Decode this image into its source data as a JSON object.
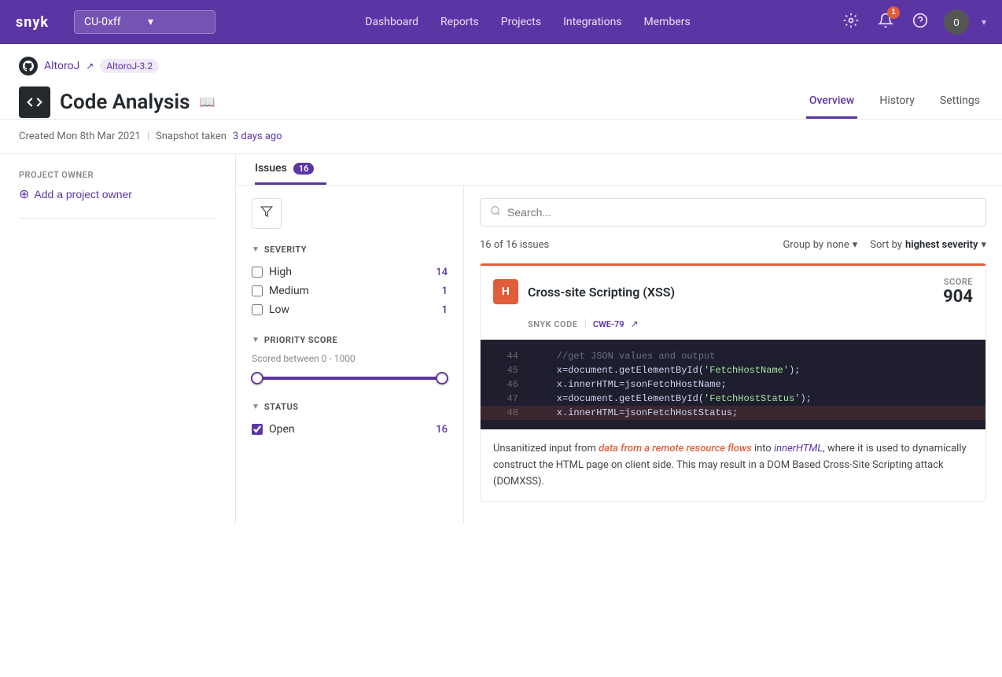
{
  "topnav": {
    "logo": "snyk",
    "org_selector": "CU-0xff",
    "nav_items": [
      "Dashboard",
      "Reports",
      "Projects",
      "Integrations",
      "Members"
    ],
    "notification_count": "1",
    "avatar_label": "0"
  },
  "breadcrumb": {
    "repo_name": "AltoroJ",
    "repo_tag": "AltoroJ-3.2",
    "external_icon": "↗"
  },
  "page": {
    "title": "Code Analysis",
    "doc_icon": "📖",
    "code_icon": "</>",
    "tabs": [
      "Overview",
      "History",
      "Settings"
    ],
    "active_tab": "Overview"
  },
  "sub_header": {
    "created": "Created Mon 8th Mar 2021",
    "snapshot_text": "Snapshot taken",
    "snapshot_link": "3 days ago"
  },
  "sidebar": {
    "project_owner_label": "PROJECT OWNER",
    "add_owner_label": "Add a project owner"
  },
  "issues_tab": {
    "label": "Issues",
    "count": "16"
  },
  "filters": {
    "severity_label": "SEVERITY",
    "severity_items": [
      {
        "label": "High",
        "count": "14",
        "checked": false
      },
      {
        "label": "Medium",
        "count": "1",
        "checked": false
      },
      {
        "label": "Low",
        "count": "1",
        "checked": false
      }
    ],
    "priority_score_label": "PRIORITY SCORE",
    "priority_range_label": "Scored between 0 - 1000",
    "priority_min": 0,
    "priority_max": 1000,
    "priority_thumb_left_pct": 3,
    "priority_thumb_right_pct": 97,
    "status_label": "STATUS",
    "status_items": [
      {
        "label": "Open",
        "count": "16",
        "checked": true
      }
    ]
  },
  "issues_list": {
    "count_text": "16 of 16 issues",
    "search_placeholder": "Search...",
    "group_by_label": "Group by",
    "group_by_value": "none",
    "sort_by_label": "Sort by",
    "sort_by_value": "highest severity"
  },
  "issue_card": {
    "severity_letter": "H",
    "title": "Cross-site Scripting (XSS)",
    "score_label": "SCORE",
    "score_value": "904",
    "meta_source": "SNYK CODE",
    "meta_cwe": "CWE-79",
    "meta_external_icon": "↗",
    "code_lines": [
      {
        "num": "44",
        "content": "    //get JSON values and output",
        "type": "comment",
        "highlighted": false
      },
      {
        "num": "45",
        "content": "    x=document.getElementById('FetchHostName');",
        "type": "code",
        "highlighted": false
      },
      {
        "num": "46",
        "content": "    x.innerHTML=jsonFetchHostName;",
        "type": "code",
        "highlighted": false
      },
      {
        "num": "47",
        "content": "    x=document.getElementById('FetchHostStatus');",
        "type": "code",
        "highlighted": false
      },
      {
        "num": "48",
        "content": "    x.innerHTML=jsonFetchHostStatus;",
        "type": "code",
        "highlighted": true
      }
    ],
    "description_parts": [
      {
        "text": "Unsanitized input from ",
        "style": "normal"
      },
      {
        "text": "data from a remote resource flows",
        "style": "orange-italic"
      },
      {
        "text": " into ",
        "style": "normal"
      },
      {
        "text": "innerHTML",
        "style": "purple-italic"
      },
      {
        "text": ", where it is used to dynamically construct the HTML page on client side. This may result in a DOM Based Cross-Site Scripting attack (DOMXSS).",
        "style": "normal"
      }
    ]
  }
}
